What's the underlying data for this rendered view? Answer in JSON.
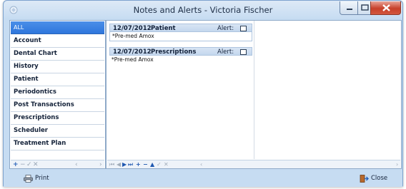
{
  "window": {
    "title": "Notes and Alerts - Victoria Fischer"
  },
  "sidebar": {
    "items": [
      {
        "label": "ALL",
        "selected": true
      },
      {
        "label": "Account"
      },
      {
        "label": "Dental Chart"
      },
      {
        "label": "History"
      },
      {
        "label": "Patient"
      },
      {
        "label": "Periodontics"
      },
      {
        "label": "Post Transactions"
      },
      {
        "label": "Prescriptions"
      },
      {
        "label": "Scheduler"
      },
      {
        "label": "Treatment Plan"
      }
    ],
    "toolbar": {
      "add": "+",
      "remove": "−",
      "edit": "✓",
      "cancel": "✕",
      "scroll_left": "‹",
      "scroll_right": "›"
    }
  },
  "notes": [
    {
      "date": "12/07/2012",
      "type": "Patient",
      "alert_label": "Alert:",
      "alert_checked": false,
      "text": "*Pre-med Amox"
    },
    {
      "date": "12/07/2012",
      "type": "Prescriptions",
      "alert_label": "Alert:",
      "alert_checked": false,
      "text": "*Pre-med Amox"
    }
  ],
  "navigator": {
    "first": "⏮",
    "prev": "◀",
    "next": "▶",
    "last": "⏭",
    "add": "+",
    "remove": "−",
    "up": "▲",
    "edit": "✓",
    "cancel": "✕",
    "scroll_left": "‹",
    "scroll_right": "›"
  },
  "footer": {
    "print_label": "Print",
    "close_label": "Close"
  },
  "colors": {
    "selected": "#2e76dc",
    "close_button": "#c7402a"
  }
}
